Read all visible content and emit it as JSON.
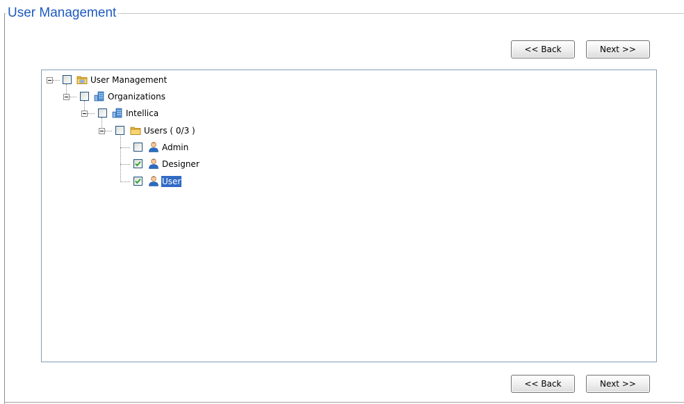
{
  "section": {
    "title": "User Management"
  },
  "nav": {
    "back_label": "<< Back",
    "next_label": "Next >>"
  },
  "tree": {
    "nodes": [
      {
        "label": "User Management",
        "icon": "folder-users-icon",
        "checked": false,
        "expanded": true
      },
      {
        "label": "Organizations",
        "icon": "building-icon",
        "checked": false,
        "expanded": true
      },
      {
        "label": "Intellica",
        "icon": "building-icon",
        "checked": false,
        "expanded": true
      },
      {
        "label": "Users ( 0/3 )",
        "icon": "folder-icon",
        "checked": false,
        "expanded": true
      },
      {
        "label": "Admin",
        "icon": "user-icon",
        "checked": false
      },
      {
        "label": "Designer",
        "icon": "user-icon",
        "checked": true
      },
      {
        "label": "User",
        "icon": "user-icon",
        "checked": true,
        "selected": true
      }
    ]
  },
  "colors": {
    "title": "#1c5abf",
    "selection": "#316ac5",
    "tree_border": "#7f9db9",
    "check": "#21a121"
  }
}
